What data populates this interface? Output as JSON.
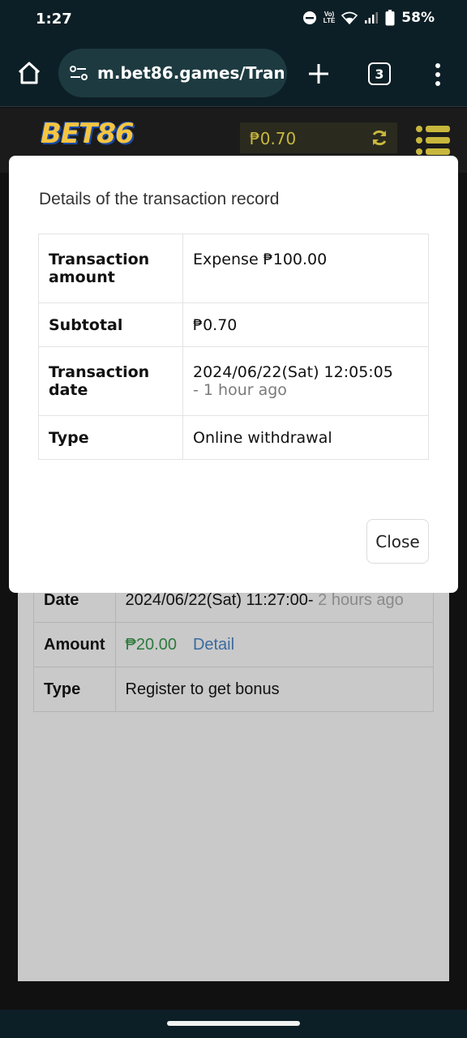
{
  "status_bar": {
    "time": "1:27",
    "network_label": "LTE",
    "battery_pct": "58%"
  },
  "browser": {
    "url": "m.bet86.games/Transa",
    "tab_count": "3"
  },
  "site": {
    "logo_text": "BET86",
    "balance": "₱0.70"
  },
  "background_record": {
    "date_label": "Date",
    "date_value": "2024/06/22(Sat) 11:27:00-",
    "date_ago": " 2 hours ago",
    "amount_label": "Amount",
    "amount_value": "₱20.00",
    "detail_link": "Detail",
    "type_label": "Type",
    "type_value": "Register to get bonus"
  },
  "modal": {
    "title": "Details of the transaction record",
    "rows": [
      {
        "label": "Transaction amount",
        "value": "Expense ₱100.00"
      },
      {
        "label": "Subtotal",
        "value": "₱0.70"
      },
      {
        "label": "Transaction date",
        "value": "2024/06/22(Sat) 12:05:05",
        "sub": "- 1 hour ago"
      },
      {
        "label": "Type",
        "value": "Online withdrawal"
      }
    ],
    "close_label": "Close"
  },
  "colors": {
    "expense": "#c62828",
    "income": "#2d7a3c",
    "link": "#3b6aa0"
  }
}
